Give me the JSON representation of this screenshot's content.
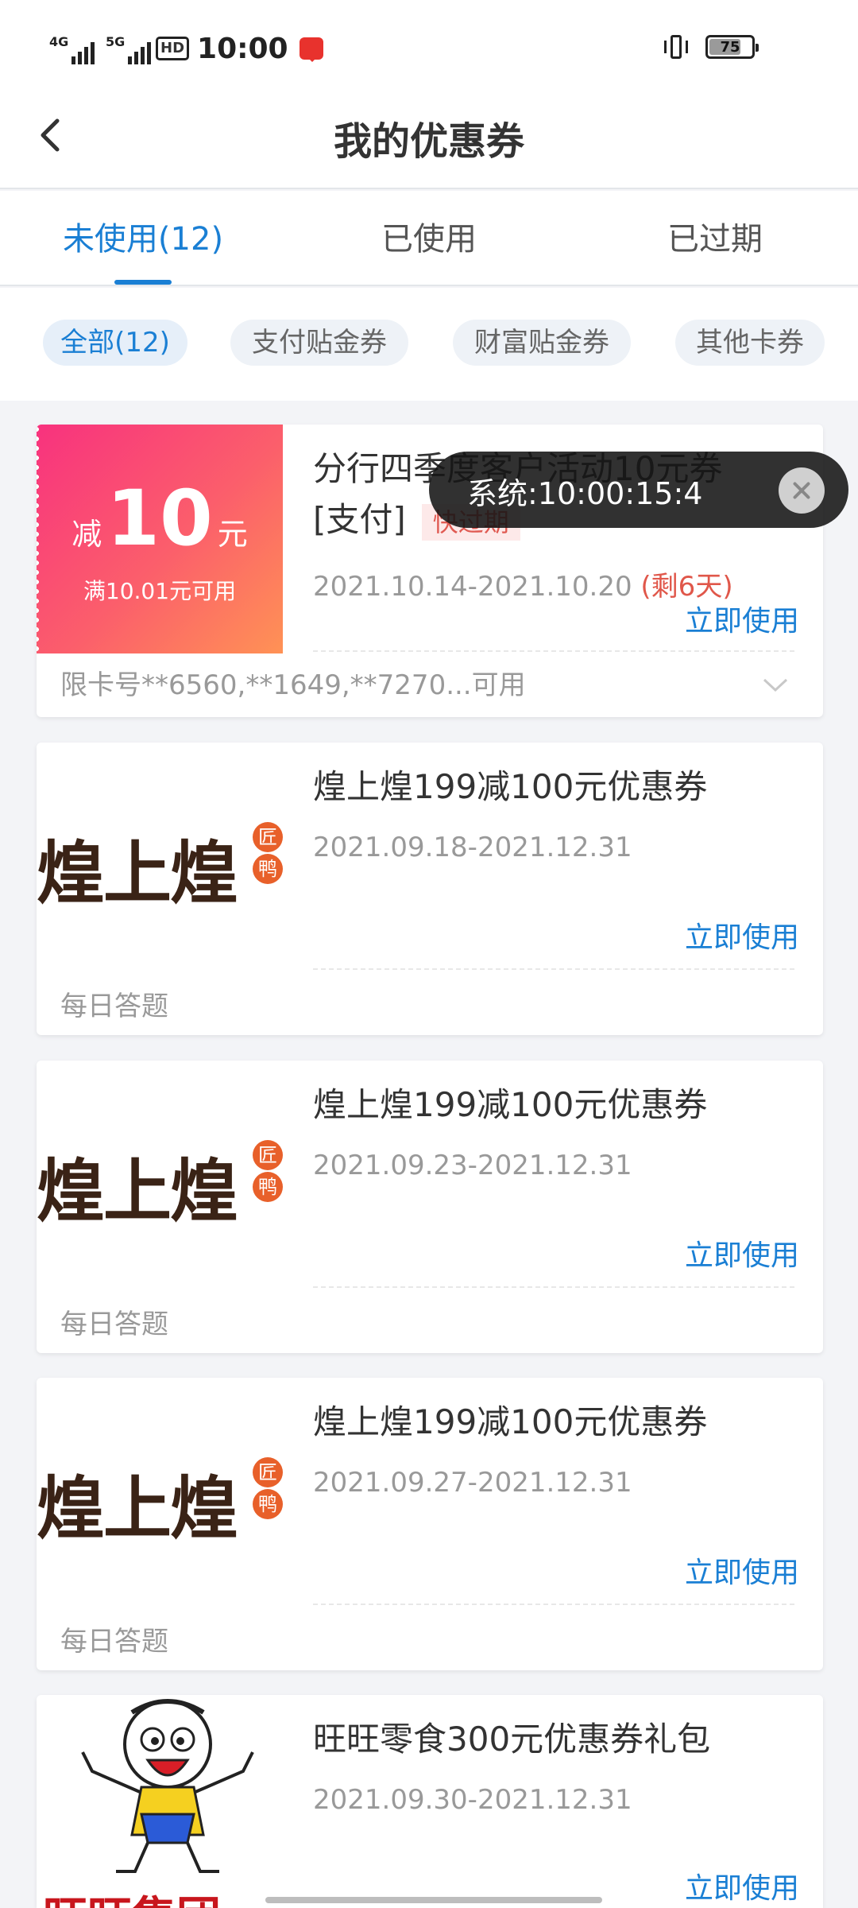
{
  "status_bar": {
    "time": "10:00",
    "network1": "4G",
    "network2": "5G",
    "hd": "HD",
    "battery": "75"
  },
  "header": {
    "title": "我的优惠券"
  },
  "tabs": [
    {
      "label": "未使用(12)",
      "active": true
    },
    {
      "label": "已使用",
      "active": false
    },
    {
      "label": "已过期",
      "active": false
    }
  ],
  "filters": [
    {
      "label": "全部(12)",
      "active": true
    },
    {
      "label": "支付贴金券",
      "active": false
    },
    {
      "label": "财富贴金券",
      "active": false
    },
    {
      "label": "其他卡券",
      "active": false
    }
  ],
  "coupons": [
    {
      "type": "discount",
      "badge": {
        "prefix": "减",
        "amount": "10",
        "unit": "元",
        "condition": "满10.01元可用"
      },
      "title_line1": "分行四季度客户活动10元券",
      "title_line2": "[支付]",
      "tag": "快过期",
      "date": "2021.10.14-2021.10.20",
      "remaining": "(剩6天)",
      "action": "立即使用",
      "footer": "限卡号**6560,**1649,**7270...可用"
    },
    {
      "type": "brand",
      "brand_name": "煌上煌",
      "brand_seal": [
        "匠",
        "鸭"
      ],
      "title_line1": "煌上煌199减100元优惠券",
      "date": "2021.09.18-2021.12.31",
      "action": "立即使用",
      "footer": "每日答题"
    },
    {
      "type": "brand",
      "brand_name": "煌上煌",
      "brand_seal": [
        "匠",
        "鸭"
      ],
      "title_line1": "煌上煌199减100元优惠券",
      "date": "2021.09.23-2021.12.31",
      "action": "立即使用",
      "footer": "每日答题"
    },
    {
      "type": "brand",
      "brand_name": "煌上煌",
      "brand_seal": [
        "匠",
        "鸭"
      ],
      "title_line1": "煌上煌199减100元优惠券",
      "date": "2021.09.27-2021.12.31",
      "action": "立即使用",
      "footer": "每日答题"
    },
    {
      "type": "brand",
      "brand_name": "旺旺集团",
      "title_line1": "旺旺零食300元优惠券礼包",
      "date": "2021.09.30-2021.12.31",
      "action": "立即使用"
    }
  ],
  "toast": {
    "text": "系统:10:00:15:4"
  },
  "colors": {
    "accent": "#1a7fd4",
    "warning": "#e0574a",
    "brand_brown": "#3a2316",
    "brand_orange": "#e8602a"
  }
}
